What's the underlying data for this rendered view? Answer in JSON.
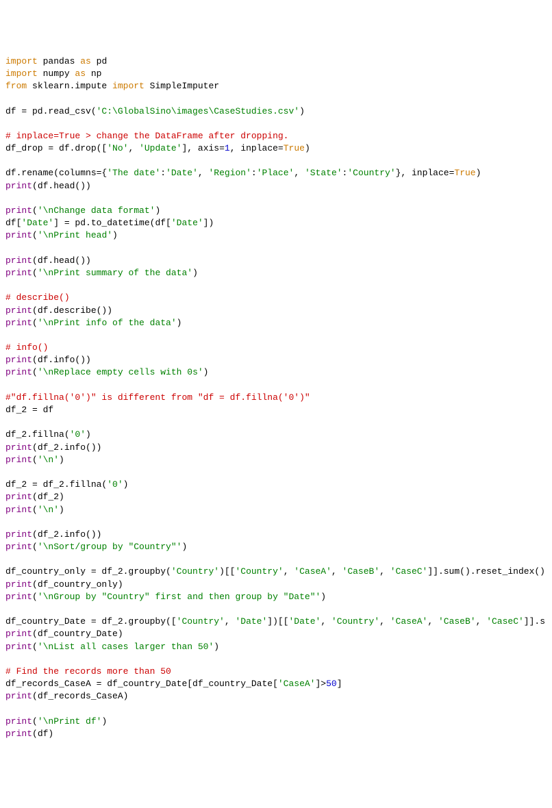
{
  "lines": [
    [
      {
        "t": "import",
        "c": "kw-orange"
      },
      {
        "t": " pandas ",
        "c": "black"
      },
      {
        "t": "as",
        "c": "kw-orange"
      },
      {
        "t": " pd",
        "c": "black"
      }
    ],
    [
      {
        "t": "import",
        "c": "kw-orange"
      },
      {
        "t": " numpy ",
        "c": "black"
      },
      {
        "t": "as",
        "c": "kw-orange"
      },
      {
        "t": " np",
        "c": "black"
      }
    ],
    [
      {
        "t": "from",
        "c": "kw-orange"
      },
      {
        "t": " sklearn.impute ",
        "c": "black"
      },
      {
        "t": "import",
        "c": "kw-orange"
      },
      {
        "t": " SimpleImputer",
        "c": "black"
      }
    ],
    [],
    [
      {
        "t": "df = pd.read_csv(",
        "c": "black"
      },
      {
        "t": "'C:\\GlobalSino\\images\\CaseStudies.csv'",
        "c": "str-green"
      },
      {
        "t": ")",
        "c": "black"
      }
    ],
    [],
    [
      {
        "t": "# inplace=True > change the DataFrame after dropping.",
        "c": "kw-red"
      }
    ],
    [
      {
        "t": "df_drop = df.drop([",
        "c": "black"
      },
      {
        "t": "'No'",
        "c": "str-green"
      },
      {
        "t": ", ",
        "c": "black"
      },
      {
        "t": "'Update'",
        "c": "str-green"
      },
      {
        "t": "], axis=",
        "c": "black"
      },
      {
        "t": "1",
        "c": "blue"
      },
      {
        "t": ", inplace=",
        "c": "black"
      },
      {
        "t": "True",
        "c": "kw-orange"
      },
      {
        "t": ")",
        "c": "black"
      }
    ],
    [],
    [
      {
        "t": "df.rename(columns={",
        "c": "black"
      },
      {
        "t": "'The date'",
        "c": "str-green"
      },
      {
        "t": ":",
        "c": "black"
      },
      {
        "t": "'Date'",
        "c": "str-green"
      },
      {
        "t": ", ",
        "c": "black"
      },
      {
        "t": "'Region'",
        "c": "str-green"
      },
      {
        "t": ":",
        "c": "black"
      },
      {
        "t": "'Place'",
        "c": "str-green"
      },
      {
        "t": ", ",
        "c": "black"
      },
      {
        "t": "'State'",
        "c": "str-green"
      },
      {
        "t": ":",
        "c": "black"
      },
      {
        "t": "'Country'",
        "c": "str-green"
      },
      {
        "t": "}, inplace=",
        "c": "black"
      },
      {
        "t": "True",
        "c": "kw-orange"
      },
      {
        "t": ")",
        "c": "black"
      }
    ],
    [
      {
        "t": "print",
        "c": "kw-purple"
      },
      {
        "t": "(df.head())",
        "c": "black"
      }
    ],
    [],
    [
      {
        "t": "print",
        "c": "kw-purple"
      },
      {
        "t": "(",
        "c": "black"
      },
      {
        "t": "'\\nChange data format'",
        "c": "str-green"
      },
      {
        "t": ")",
        "c": "black"
      }
    ],
    [
      {
        "t": "df[",
        "c": "black"
      },
      {
        "t": "'Date'",
        "c": "str-green"
      },
      {
        "t": "] = pd.to_datetime(df[",
        "c": "black"
      },
      {
        "t": "'Date'",
        "c": "str-green"
      },
      {
        "t": "])",
        "c": "black"
      }
    ],
    [
      {
        "t": "print",
        "c": "kw-purple"
      },
      {
        "t": "(",
        "c": "black"
      },
      {
        "t": "'\\nPrint head'",
        "c": "str-green"
      },
      {
        "t": ")",
        "c": "black"
      }
    ],
    [],
    [
      {
        "t": "print",
        "c": "kw-purple"
      },
      {
        "t": "(df.head())",
        "c": "black"
      }
    ],
    [
      {
        "t": "print",
        "c": "kw-purple"
      },
      {
        "t": "(",
        "c": "black"
      },
      {
        "t": "'\\nPrint summary of the data'",
        "c": "str-green"
      },
      {
        "t": ")",
        "c": "black"
      }
    ],
    [],
    [
      {
        "t": "# describe()",
        "c": "kw-red"
      }
    ],
    [
      {
        "t": "print",
        "c": "kw-purple"
      },
      {
        "t": "(df.describe())",
        "c": "black"
      }
    ],
    [
      {
        "t": "print",
        "c": "kw-purple"
      },
      {
        "t": "(",
        "c": "black"
      },
      {
        "t": "'\\nPrint info of the data'",
        "c": "str-green"
      },
      {
        "t": ")",
        "c": "black"
      }
    ],
    [],
    [
      {
        "t": "# info()",
        "c": "kw-red"
      }
    ],
    [
      {
        "t": "print",
        "c": "kw-purple"
      },
      {
        "t": "(df.info())",
        "c": "black"
      }
    ],
    [
      {
        "t": "print",
        "c": "kw-purple"
      },
      {
        "t": "(",
        "c": "black"
      },
      {
        "t": "'\\nReplace empty cells with 0s'",
        "c": "str-green"
      },
      {
        "t": ")",
        "c": "black"
      }
    ],
    [],
    [
      {
        "t": "#\"df.fillna('0')\" is different from \"df = df.fillna('0')\"",
        "c": "kw-red"
      }
    ],
    [
      {
        "t": "df_2 = df",
        "c": "black"
      }
    ],
    [],
    [
      {
        "t": "df_2.fillna(",
        "c": "black"
      },
      {
        "t": "'0'",
        "c": "str-green"
      },
      {
        "t": ")",
        "c": "black"
      }
    ],
    [
      {
        "t": "print",
        "c": "kw-purple"
      },
      {
        "t": "(df_2.info())",
        "c": "black"
      }
    ],
    [
      {
        "t": "print",
        "c": "kw-purple"
      },
      {
        "t": "(",
        "c": "black"
      },
      {
        "t": "'\\n'",
        "c": "str-green"
      },
      {
        "t": ")",
        "c": "black"
      }
    ],
    [],
    [
      {
        "t": "df_2 = df_2.fillna(",
        "c": "black"
      },
      {
        "t": "'0'",
        "c": "str-green"
      },
      {
        "t": ")",
        "c": "black"
      }
    ],
    [
      {
        "t": "print",
        "c": "kw-purple"
      },
      {
        "t": "(df_2)",
        "c": "black"
      }
    ],
    [
      {
        "t": "print",
        "c": "kw-purple"
      },
      {
        "t": "(",
        "c": "black"
      },
      {
        "t": "'\\n'",
        "c": "str-green"
      },
      {
        "t": ")",
        "c": "black"
      }
    ],
    [],
    [
      {
        "t": "print",
        "c": "kw-purple"
      },
      {
        "t": "(df_2.info())",
        "c": "black"
      }
    ],
    [
      {
        "t": "print",
        "c": "kw-purple"
      },
      {
        "t": "(",
        "c": "black"
      },
      {
        "t": "'\\nSort/group by \"Country\"'",
        "c": "str-green"
      },
      {
        "t": ")",
        "c": "black"
      }
    ],
    [],
    [
      {
        "t": "df_country_only = df_2.groupby(",
        "c": "black"
      },
      {
        "t": "'Country'",
        "c": "str-green"
      },
      {
        "t": ")[[",
        "c": "black"
      },
      {
        "t": "'Country'",
        "c": "str-green"
      },
      {
        "t": ", ",
        "c": "black"
      },
      {
        "t": "'CaseA'",
        "c": "str-green"
      },
      {
        "t": ", ",
        "c": "black"
      },
      {
        "t": "'CaseB'",
        "c": "str-green"
      },
      {
        "t": ", ",
        "c": "black"
      },
      {
        "t": "'CaseC'",
        "c": "str-green"
      },
      {
        "t": "]].sum().reset_index()",
        "c": "black"
      }
    ],
    [
      {
        "t": "print",
        "c": "kw-purple"
      },
      {
        "t": "(df_country_only)",
        "c": "black"
      }
    ],
    [
      {
        "t": "print",
        "c": "kw-purple"
      },
      {
        "t": "(",
        "c": "black"
      },
      {
        "t": "'\\nGroup by \"Country\" first and then group by \"Date\"'",
        "c": "str-green"
      },
      {
        "t": ")",
        "c": "black"
      }
    ],
    [],
    [
      {
        "t": "df_country_Date = df_2.groupby([",
        "c": "black"
      },
      {
        "t": "'Country'",
        "c": "str-green"
      },
      {
        "t": ", ",
        "c": "black"
      },
      {
        "t": "'Date'",
        "c": "str-green"
      },
      {
        "t": "])[[",
        "c": "black"
      },
      {
        "t": "'Date'",
        "c": "str-green"
      },
      {
        "t": ", ",
        "c": "black"
      },
      {
        "t": "'Country'",
        "c": "str-green"
      },
      {
        "t": ", ",
        "c": "black"
      },
      {
        "t": "'CaseA'",
        "c": "str-green"
      },
      {
        "t": ", ",
        "c": "black"
      },
      {
        "t": "'CaseB'",
        "c": "str-green"
      },
      {
        "t": ", ",
        "c": "black"
      },
      {
        "t": "'CaseC'",
        "c": "str-green"
      },
      {
        "t": "]].s",
        "c": "black"
      }
    ],
    [
      {
        "t": "print",
        "c": "kw-purple"
      },
      {
        "t": "(df_country_Date)",
        "c": "black"
      }
    ],
    [
      {
        "t": "print",
        "c": "kw-purple"
      },
      {
        "t": "(",
        "c": "black"
      },
      {
        "t": "'\\nList all cases larger than 50'",
        "c": "str-green"
      },
      {
        "t": ")",
        "c": "black"
      }
    ],
    [],
    [
      {
        "t": "# Find the records more than 50",
        "c": "kw-red"
      }
    ],
    [
      {
        "t": "df_records_CaseA = df_country_Date[df_country_Date[",
        "c": "black"
      },
      {
        "t": "'CaseA'",
        "c": "str-green"
      },
      {
        "t": "]>",
        "c": "black"
      },
      {
        "t": "50",
        "c": "blue"
      },
      {
        "t": "]",
        "c": "black"
      }
    ],
    [
      {
        "t": "print",
        "c": "kw-purple"
      },
      {
        "t": "(df_records_CaseA)",
        "c": "black"
      }
    ],
    [],
    [
      {
        "t": "print",
        "c": "kw-purple"
      },
      {
        "t": "(",
        "c": "black"
      },
      {
        "t": "'\\nPrint df'",
        "c": "str-green"
      },
      {
        "t": ")",
        "c": "black"
      }
    ],
    [
      {
        "t": "print",
        "c": "kw-purple"
      },
      {
        "t": "(df)",
        "c": "black"
      }
    ]
  ]
}
